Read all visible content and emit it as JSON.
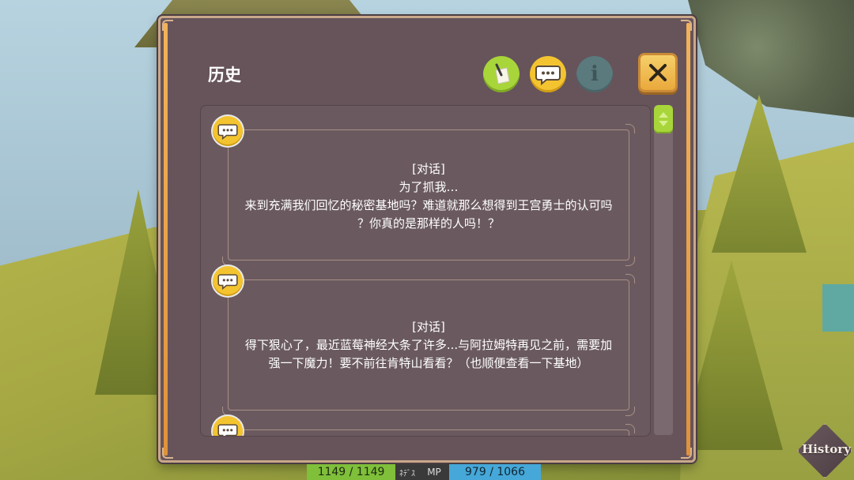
{
  "dialog": {
    "title": "历史",
    "tabs": [
      {
        "name": "all",
        "icon": "note-icon",
        "color": "#a8d63a"
      },
      {
        "name": "dialogue",
        "icon": "speech-bubble-icon",
        "color": "#f4c430"
      },
      {
        "name": "info",
        "label": "i",
        "icon": "info-icon",
        "color": "#5b7a7e"
      }
    ],
    "close_icon": "close-icon"
  },
  "entries": [
    {
      "type": "[对话]",
      "line1": "为了抓我…",
      "line2": "来到充满我们回忆的秘密基地吗？难道就那么想得到王宫勇士的认可吗",
      "line3": "？你真的是那样的人吗！？"
    },
    {
      "type": "[对话]",
      "line1": "得下狠心了，最近蓝莓神经大条了许多...与阿拉姆特再见之前，需要加",
      "line2": "强一下魔力！要不前往肯特山看看？（也顺便查看一下基地）"
    }
  ],
  "hud": {
    "hp": "1149 / 1149",
    "small_label": "ﾈﾃﾞｽ",
    "mp_label": "MP",
    "mp": "979 / 1066"
  },
  "history_button": {
    "label": "History"
  }
}
